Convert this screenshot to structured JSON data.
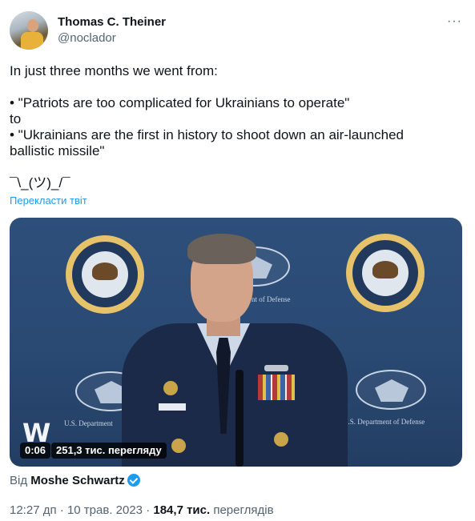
{
  "author": {
    "name": "Thomas C. Theiner",
    "handle": "@noclador",
    "more_icon": "more-horizontal-icon",
    "more_glyph": "···"
  },
  "tweet": {
    "lines": [
      "In just three months we went from:",
      "",
      "• \"Patriots are too complicated for Ukrainians to operate\"",
      "to",
      "• \"Ukrainians are the first in history to shoot down an air-launched",
      "ballistic missile\"",
      "",
      "¯\\_(ツ)_/¯"
    ],
    "translate_label": "Перекласти твіт"
  },
  "media": {
    "video_time": "0:06",
    "video_views": "251,3 тис. перегляду",
    "watermark_logo": "W",
    "backdrop_label_left": "U.S. Department",
    "backdrop_label_center": "nt of Defense",
    "backdrop_label_right": "U.S. Department of Defense"
  },
  "attribution": {
    "prefix": "Від",
    "source_name": "Moshe Schwartz",
    "verified_icon": "verified-badge-icon"
  },
  "meta": {
    "time": "12:27 дп",
    "separator": "·",
    "date": "10 трав. 2023",
    "view_count": "184,7 тис.",
    "view_label": "переглядів"
  },
  "colors": {
    "link": "#1d9bf0",
    "text": "#0f1419",
    "muted": "#536471"
  }
}
